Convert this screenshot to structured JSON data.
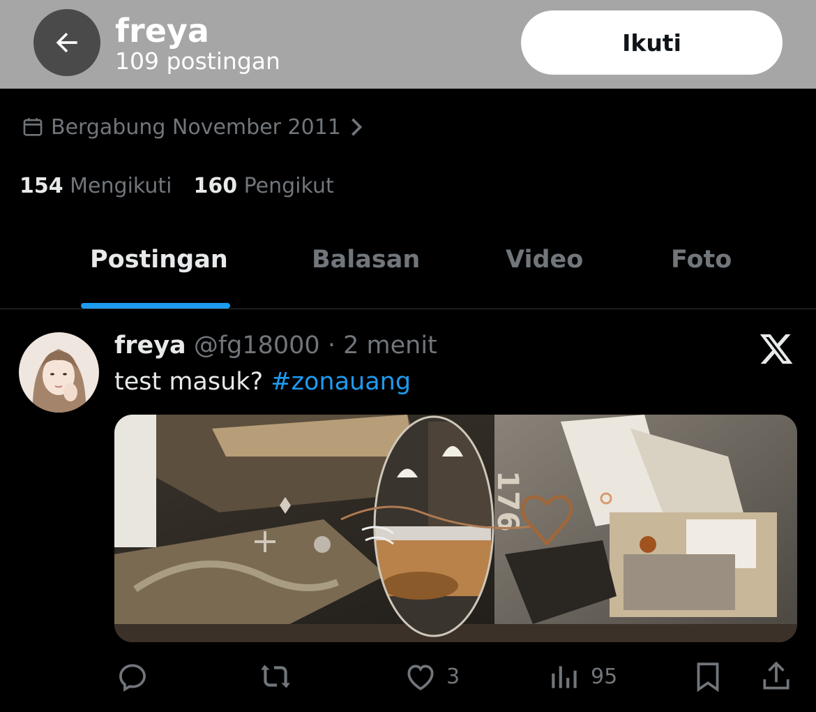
{
  "header": {
    "name": "freya",
    "post_count": "109 postingan",
    "follow_label": "Ikuti"
  },
  "profile": {
    "joined": "Bergabung November 2011",
    "following_count": "154",
    "following_label": "Mengikuti",
    "followers_count": "160",
    "followers_label": "Pengikut"
  },
  "tabs": [
    {
      "label": "Postingan",
      "active": true
    },
    {
      "label": "Balasan",
      "active": false
    },
    {
      "label": "Video",
      "active": false
    },
    {
      "label": "Foto",
      "active": false
    }
  ],
  "post": {
    "author_name": "freya",
    "handle": "@fg18000",
    "separator": "·",
    "time": "2 menit",
    "text": "test masuk?",
    "hashtag": "#zonauang",
    "image_text": "176",
    "actions": {
      "reply_icon": "reply-icon",
      "repost_icon": "repost-icon",
      "like_count": "3",
      "views_count": "95",
      "bookmark_icon": "bookmark-icon",
      "share_icon": "share-icon"
    }
  },
  "colors": {
    "accent": "#1d9bf0",
    "background": "#000000",
    "header_bg": "#a6a6a6",
    "muted_text": "#71767b",
    "primary_text": "#e7e9ea"
  }
}
